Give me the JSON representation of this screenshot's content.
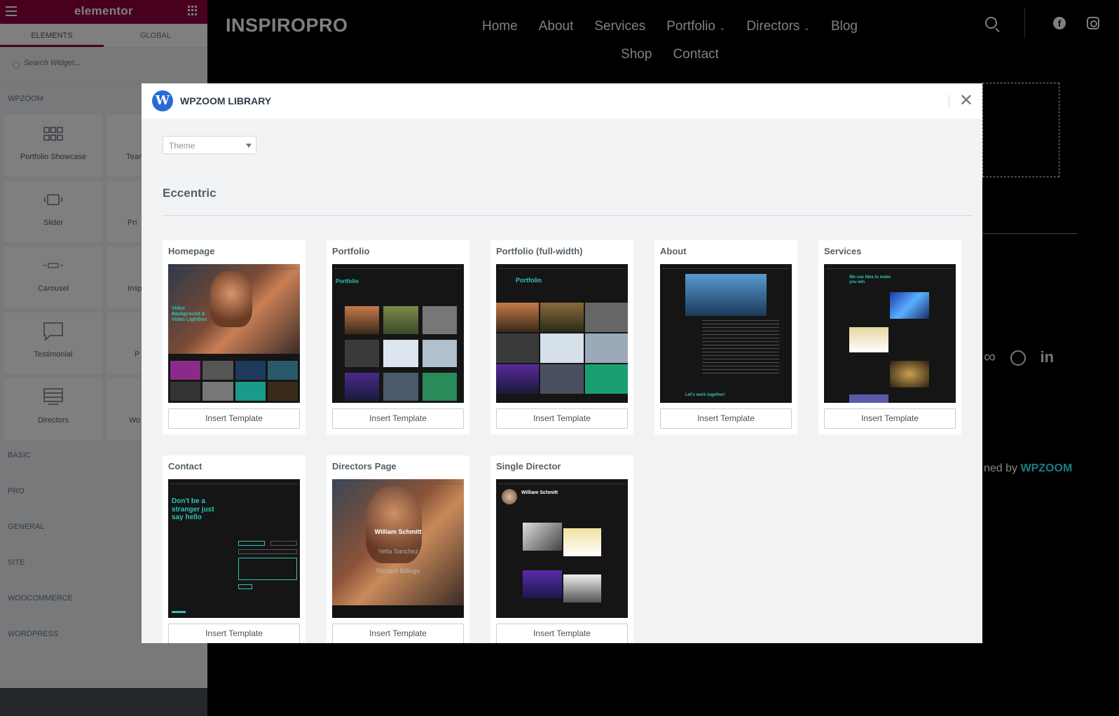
{
  "panel": {
    "logo": "elementor",
    "tabs": [
      "ELEMENTS",
      "GLOBAL"
    ],
    "search_placeholder": "Search Widget...",
    "category": "WPZOOM",
    "widgets": [
      "Portfolio Showcase",
      "Team",
      "Slider",
      "Pri",
      "Carousel",
      "Inspi",
      "Testimonial",
      "P",
      "Directors",
      "Wo"
    ],
    "sections": [
      "BASIC",
      "PRO",
      "GENERAL",
      "SITE",
      "WOOCOMMERCE",
      "WORDPRESS"
    ]
  },
  "site": {
    "brand": "INSPIROPRO",
    "nav_row1": [
      "Home",
      "About",
      "Services",
      "Portfolio",
      "Directors",
      "Blog"
    ],
    "nav_row2": [
      "Shop",
      "Contact"
    ],
    "footer_peek": "ned by",
    "footer_brand": "WPZOOM"
  },
  "modal": {
    "title": "WPZOOM LIBRARY",
    "filter_value": "Theme",
    "section": "Eccentric",
    "button_label": "Insert Template",
    "templates": [
      {
        "title": "Homepage"
      },
      {
        "title": "Portfolio"
      },
      {
        "title": "Portfolio (full-width)"
      },
      {
        "title": "About"
      },
      {
        "title": "Services"
      },
      {
        "title": "Contact"
      },
      {
        "title": "Directors Page"
      },
      {
        "title": "Single Director"
      }
    ]
  },
  "thumbs": {
    "portfolio_heading": "Portfolio",
    "about_cta": "Let's work together!",
    "services_heading": "We use Idea to make you win",
    "contact_heading": "Don't be a stranger just say hello",
    "directors_names": [
      "William Schmitt",
      "Yetta Sanchez",
      "Richard Billings"
    ],
    "single_director_name": "William Schmitt"
  },
  "colors": {
    "accent": "#2ec4b6",
    "brand_red": "#93003c",
    "link_blue": "#2a6ad6"
  }
}
